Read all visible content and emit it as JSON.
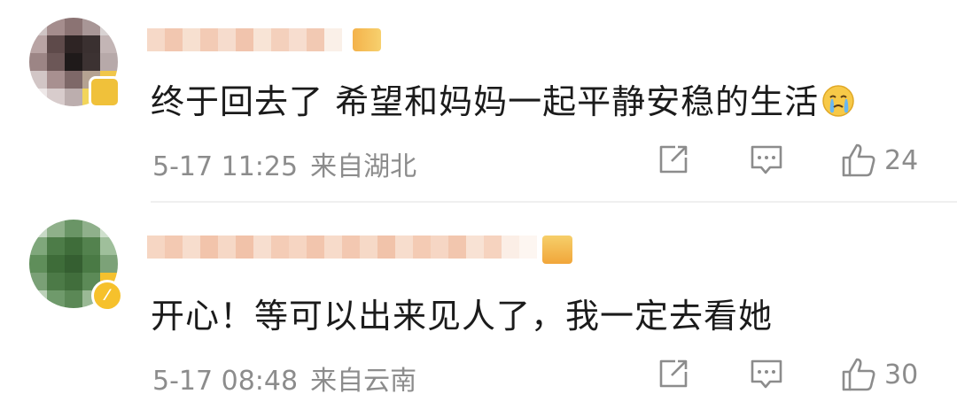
{
  "comments": [
    {
      "text": "终于回去了 希望和妈妈一起平静安稳的生活",
      "emoji": "crying-face-icon",
      "date_time": "5-17 11:25",
      "location": "来自湖北",
      "likes": "24",
      "avatar_colors": [
        "#cfc4c4",
        "#a58d8d",
        "#8b7373",
        "#a89696",
        "#d8d2d2",
        "#b9a4a4",
        "#5e4a4a",
        "#2e2424",
        "#3a3030",
        "#c3b5b5",
        "#9c8585",
        "#6c5757",
        "#1f1a1a",
        "#3c3232",
        "#b7a9a9",
        "#d2c6c6",
        "#a89090",
        "#7e6868",
        "#b5a292",
        "#f0c64a",
        "#eee8e8",
        "#d8cccc",
        "#bcaeae",
        "#f2d55a",
        "#f4c640"
      ],
      "username_colors": [
        "#f6d9c8",
        "#f2c7b0",
        "#f7e0d0",
        "#f3cbb5",
        "#f6dccd",
        "#f1c4ad",
        "#f8e4d6",
        "#f4d0bc",
        "#f7ddcf",
        "#f2c9b3",
        "#faf0e8"
      ]
    },
    {
      "text": "开心！等可以出来见人了，我一定去看她",
      "date_time": "5-17 08:48",
      "location": "来自云南",
      "likes": "30",
      "avatar_colors": [
        "#c8d9c6",
        "#8fb08a",
        "#6a9566",
        "#8fb08b",
        "#cfe0cd",
        "#7fa77b",
        "#4d7c48",
        "#3f6d3a",
        "#53824e",
        "#9fbf9b",
        "#5f8e5a",
        "#3e6c39",
        "#355f31",
        "#4a7a45",
        "#7ca278",
        "#7aa076",
        "#4c7a47",
        "#416e3c",
        "#5c8a57",
        "#f4c12f",
        "#bcd1b9",
        "#6f9a6b",
        "#5b8856",
        "#9ab995",
        "#f4c12f"
      ],
      "username_colors": [
        "#f6d6c3",
        "#f3c9b2",
        "#f7ddcd",
        "#f2c4ab",
        "#f6d8c6",
        "#f1c2a9",
        "#f7decf",
        "#f4ccb6",
        "#f6d5c2",
        "#f2c5ad",
        "#f7dbca",
        "#f3c8b1",
        "#f6d9c7",
        "#f1c3aa",
        "#f7ddcd",
        "#f4cbb4",
        "#f6d6c4",
        "#f2c6ae",
        "#f8e2d4",
        "#f6d3bf",
        "#fbeee6",
        "#fdf6f1"
      ]
    }
  ],
  "colors": {
    "text_primary": "#1b1b1b",
    "text_secondary": "#8c8c8c",
    "vip_gold": "#f6c12c",
    "divider": "#efefef"
  },
  "icons": {
    "share": "share-square-arrow-icon",
    "reply": "comment-bubble-icon",
    "like": "thumbs-up-icon"
  }
}
